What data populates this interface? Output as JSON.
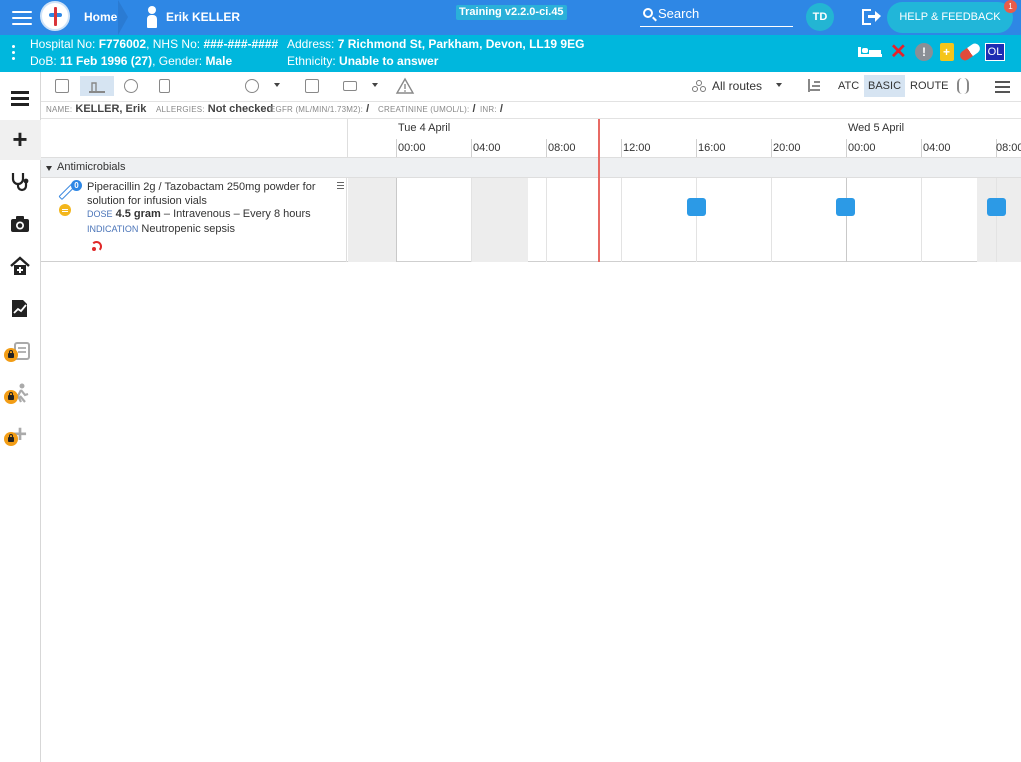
{
  "topbar": {
    "home_label": "Home",
    "patient_name": "Erik KELLER",
    "build_label": "Training v2.2.0-ci.45",
    "search_placeholder": "Search",
    "user_initials": "TD",
    "help_label": "HELP & FEEDBACK",
    "help_badge": "1"
  },
  "banner": {
    "hospital_no_label": "Hospital No:",
    "hospital_no": "F776002",
    "nhs_no_label": "NHS No:",
    "nhs_no": "###-###-####",
    "dob_label": "DoB:",
    "dob": "11 Feb 1996 (27)",
    "gender_label": "Gender:",
    "gender": "Male",
    "address_label": "Address:",
    "address": "7 Richmond St, Parkham, Devon, LL19 9EG",
    "ethnicity_label": "Ethnicity:",
    "ethnicity": "Unable to answer",
    "ol_badge": "OL",
    "alert_glyph": "!"
  },
  "sidebar": {
    "icons": [
      "list-icon",
      "add-icon",
      "stethoscope-icon",
      "camera-icon",
      "home-plus-icon",
      "chart-edit-icon",
      "locked-clipboard-icon",
      "locked-person-icon",
      "locked-plus-icon"
    ]
  },
  "toolbar": {
    "routes_label": "All routes",
    "atc_label": "ATC",
    "basic_label": "BASIC",
    "route_label": "ROUTE"
  },
  "patient_info": {
    "name_label": "NAME:",
    "name": "KELLER, Erik",
    "allergies_label": "ALLERGIES:",
    "allergies": "Not checked",
    "egfr_label": "EGFR (ML/MIN/1.73M2):",
    "egfr": "/",
    "creatinine_label": "CREATININE (UMOL/L):",
    "creatinine": "/",
    "inr_label": "INR:",
    "inr": "/"
  },
  "timeline": {
    "days": [
      "Tue 4 April",
      "Wed 5 April"
    ],
    "hours": [
      "00:00",
      "04:00",
      "08:00",
      "12:00",
      "16:00",
      "20:00",
      "00:00",
      "04:00",
      "08:00"
    ]
  },
  "groups": [
    {
      "name": "Antimicrobials",
      "items": [
        {
          "title": "Piperacillin 2g / Tazobactam 250mg powder for solution for infusion vials",
          "count": "0",
          "dose_tag": "DOSE",
          "dose": "4.5 gram",
          "dose_rest": "– Intravenous – Every 8 hours",
          "indication_tag": "INDICATION",
          "indication": "Neutropenic sepsis"
        }
      ]
    }
  ],
  "colors": {
    "topbar": "#2e87e5",
    "banner": "#00b7dd",
    "dose_mark": "#2c9ae6",
    "now_line": "#e86a64",
    "lock": "#f29d16"
  }
}
